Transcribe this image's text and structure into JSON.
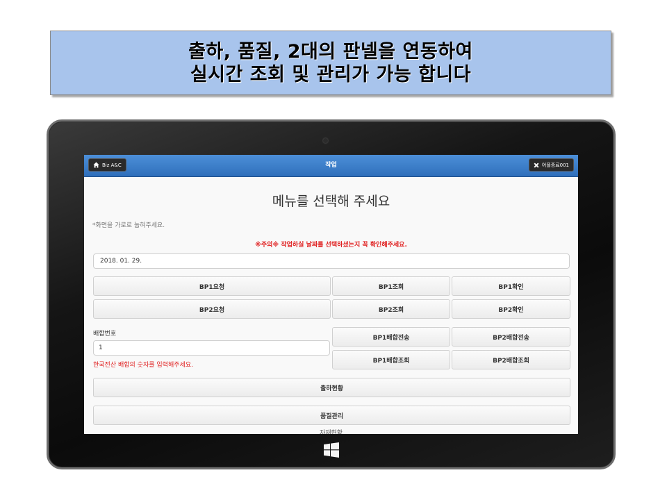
{
  "banner": {
    "line1": "출하, 품질, 2대의 판넬을 연동하여",
    "line2": "실시간 조회 및 관리가 가능 합니다"
  },
  "header": {
    "home_label": "Biz A&C",
    "title": "작업",
    "close_label": "어플종료001"
  },
  "main": {
    "menu_title": "메뉴를 선택해 주세요",
    "hint": "*화면을 가로로 눕혀주세요.",
    "warning": "※주의※ 작업하실 날짜를 선택하셨는지 꼭 확인해주세요.",
    "date_value": "2018. 01. 29.",
    "bp1_request": "BP1요청",
    "bp1_query": "BP1조회",
    "bp1_confirm": "BP1확인",
    "bp2_request": "BP2요청",
    "bp2_query": "BP2조회",
    "bp2_confirm": "BP2확인",
    "mix_label": "배합번호",
    "mix_value": "1",
    "mix_warning": "한국전산 배합의 숫자를 입력해주세요.",
    "bp1_mix_send": "BP1배합전송",
    "bp2_mix_send": "BP2배합전송",
    "bp1_mix_query": "BP1배합조회",
    "bp2_mix_query": "BP2배합조회",
    "shipping_status": "출하현황",
    "quality_manage": "품질관리",
    "cut_off_item": "자재현황"
  }
}
